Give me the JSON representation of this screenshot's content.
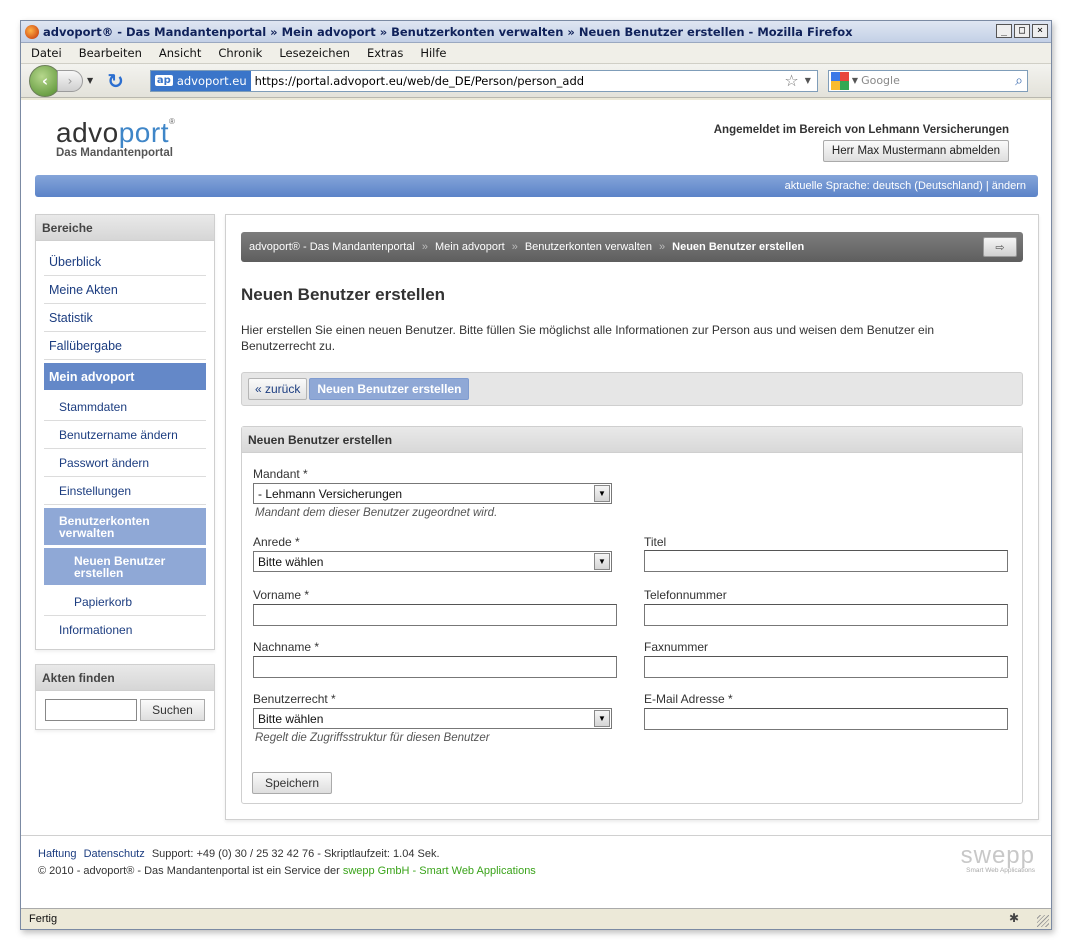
{
  "browser": {
    "title": "advoport® - Das Mandantenportal  »  Mein advoport  »  Benutzerkonten verwalten  »  Neuen Benutzer erstellen - Mozilla Firefox",
    "menu": [
      "Datei",
      "Bearbeiten",
      "Ansicht",
      "Chronik",
      "Lesezeichen",
      "Extras",
      "Hilfe"
    ],
    "site_badge_prefix": "ap",
    "site_identity": "advoport.eu",
    "url": "https://portal.advoport.eu/web/de_DE/Person/person_add",
    "search_placeholder": "Google",
    "status": "Fertig"
  },
  "header": {
    "logo_part1": "advo",
    "logo_part2": "port",
    "logo_reg": "®",
    "logo_subtitle": "Das Mandantenportal",
    "login_info": "Angemeldet im Bereich von Lehmann Versicherungen",
    "logout_label": "Herr Max Mustermann abmelden",
    "language_bar": "aktuelle Sprache: deutsch (Deutschland) | ändern"
  },
  "sidebar": {
    "areas_title": "Bereiche",
    "items": {
      "overview": "Überblick",
      "my_files": "Meine Akten",
      "statistics": "Statistik",
      "case_transfer": "Fallübergabe",
      "my_advoport": "Mein advoport",
      "master_data": "Stammdaten",
      "change_username": "Benutzername ändern",
      "change_password": "Passwort ändern",
      "settings": "Einstellungen",
      "manage_accounts": "Benutzerkonten verwalten",
      "new_user": "Neuen Benutzer erstellen",
      "trash": "Papierkorb",
      "information": "Informationen"
    },
    "find_title": "Akten finden",
    "find_button": "Suchen"
  },
  "main": {
    "breadcrumb": [
      "advoport® - Das Mandantenportal",
      "Mein advoport",
      "Benutzerkonten verwalten",
      "Neuen Benutzer erstellen"
    ],
    "breadcrumb_sep": "»",
    "title": "Neuen Benutzer erstellen",
    "intro": "Hier erstellen Sie einen neuen Benutzer. Bitte füllen Sie möglichst alle Informationen zur Person aus und weisen dem Benutzer ein Benutzerrecht zu.",
    "back_label": "« zurück",
    "active_tab": "Neuen Benutzer erstellen",
    "form": {
      "header": "Neuen Benutzer erstellen",
      "client_label": "Mandant *",
      "client_value": "- Lehmann Versicherungen",
      "client_hint": "Mandant dem dieser Benutzer zugeordnet wird.",
      "salutation_label": "Anrede *",
      "salutation_value": "Bitte wählen",
      "title_label": "Titel",
      "firstname_label": "Vorname *",
      "phone_label": "Telefonnummer",
      "lastname_label": "Nachname *",
      "fax_label": "Faxnummer",
      "rights_label": "Benutzerrecht *",
      "rights_value": "Bitte wählen",
      "rights_hint": "Regelt die Zugriffsstruktur für diesen Benutzer",
      "email_label": "E-Mail Adresse *",
      "save_label": "Speichern"
    }
  },
  "footer": {
    "link_liability": "Haftung",
    "link_privacy": "Datenschutz",
    "support_text": "Support: +49 (0) 30 / 25 32 42 76 - Skriptlaufzeit: 1.04 Sek.",
    "copyright_text": "© 2010 - advoport® - Das Mandantenportal ist ein Service der",
    "company_link": "swepp GmbH - Smart Web Applications",
    "swepp_logo": "swepp",
    "swepp_tagline": "Smart Web Applications"
  }
}
